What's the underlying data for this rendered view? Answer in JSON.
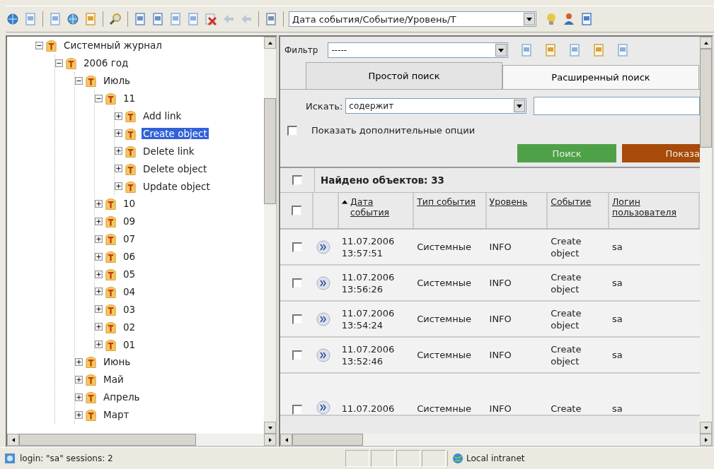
{
  "toolbar": {
    "view_select": "Дата события/Событие/Уровень/Т"
  },
  "tree": [
    {
      "label": "Системный журнал",
      "expanded": true,
      "selected": false,
      "children": [
        {
          "label": "2006 год",
          "expanded": true,
          "selected": false,
          "children": [
            {
              "label": "Июль",
              "expanded": true,
              "selected": false,
              "children": [
                {
                  "label": "11",
                  "expanded": true,
                  "selected": false,
                  "children": [
                    {
                      "label": "Add link",
                      "expanded": false,
                      "selected": false
                    },
                    {
                      "label": "Create object",
                      "expanded": false,
                      "selected": true
                    },
                    {
                      "label": "Delete link",
                      "expanded": false,
                      "selected": false
                    },
                    {
                      "label": "Delete object",
                      "expanded": false,
                      "selected": false
                    },
                    {
                      "label": "Update object",
                      "expanded": false,
                      "selected": false
                    }
                  ]
                },
                {
                  "label": "10",
                  "expanded": false,
                  "selected": false
                },
                {
                  "label": "09",
                  "expanded": false,
                  "selected": false
                },
                {
                  "label": "07",
                  "expanded": false,
                  "selected": false
                },
                {
                  "label": "06",
                  "expanded": false,
                  "selected": false
                },
                {
                  "label": "05",
                  "expanded": false,
                  "selected": false
                },
                {
                  "label": "04",
                  "expanded": false,
                  "selected": false
                },
                {
                  "label": "03",
                  "expanded": false,
                  "selected": false
                },
                {
                  "label": "02",
                  "expanded": false,
                  "selected": false
                },
                {
                  "label": "01",
                  "expanded": false,
                  "selected": false
                }
              ]
            },
            {
              "label": "Июнь",
              "expanded": false,
              "selected": false
            },
            {
              "label": "Май",
              "expanded": false,
              "selected": false
            },
            {
              "label": "Апрель",
              "expanded": false,
              "selected": false
            },
            {
              "label": "Март",
              "expanded": false,
              "selected": false
            }
          ]
        }
      ]
    }
  ],
  "filter": {
    "label": "Фильтр",
    "value": "-----"
  },
  "tabs": [
    {
      "label": "Простой поиск",
      "selected": true
    },
    {
      "label": "Расширенный поиск",
      "selected": false
    }
  ],
  "search": {
    "label": "Искать:",
    "mode": "содержит"
  },
  "options_checkbox": {
    "label": "Показать дополнительные опции",
    "checked": false
  },
  "buttons": [
    {
      "label": "Поиск",
      "kind": "search"
    },
    {
      "label": "Показа",
      "kind": "show"
    }
  ],
  "results": {
    "title": "Найдено объектов: 33",
    "select_all_checked": false,
    "columns": [
      {
        "label": "Дата события",
        "sorted": true
      },
      {
        "label": "Тип события",
        "sorted": false
      },
      {
        "label": "Уровень",
        "sorted": false
      },
      {
        "label": "Событие",
        "sorted": false
      },
      {
        "label": "Логин пользователя",
        "sorted": false
      }
    ],
    "header_checked": false,
    "rows": [
      {
        "checked": false,
        "date": "11.07.2006",
        "time": "13:57:51",
        "type": "Системные",
        "level": "INFO",
        "event": "Create object",
        "login": "sa"
      },
      {
        "checked": false,
        "date": "11.07.2006",
        "time": "13:56:26",
        "type": "Системные",
        "level": "INFO",
        "event": "Create object",
        "login": "sa"
      },
      {
        "checked": false,
        "date": "11.07.2006",
        "time": "13:54:24",
        "type": "Системные",
        "level": "INFO",
        "event": "Create object",
        "login": "sa"
      },
      {
        "checked": false,
        "date": "11.07.2006",
        "time": "13:52:46",
        "type": "Системные",
        "level": "INFO",
        "event": "Create object",
        "login": "sa"
      },
      {
        "checked": false,
        "date": "11.07.2006",
        "type": "Системные",
        "level": "INFO",
        "event": "Create",
        "login": "sa",
        "cut": true
      }
    ]
  },
  "status_bar": {
    "text": "login: \"sa\" sessions: 2",
    "zone": "Local intranet"
  }
}
